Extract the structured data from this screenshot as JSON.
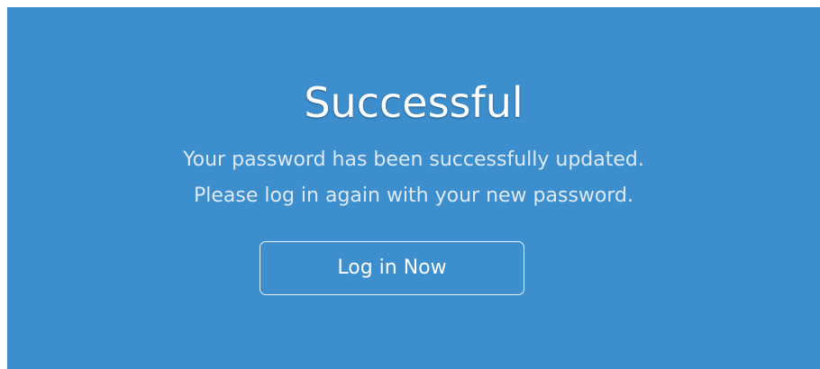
{
  "dialog": {
    "title": "Successful",
    "message_lines": [
      "Your password has been successfully updated.",
      "Please log in again with your new password."
    ],
    "login_button_label": "Log in Now"
  },
  "colors": {
    "panel_background": "#3d8ecd",
    "title_text": "#ffffff",
    "message_text": "#dde9f6",
    "button_border": "#e6f0fa"
  }
}
